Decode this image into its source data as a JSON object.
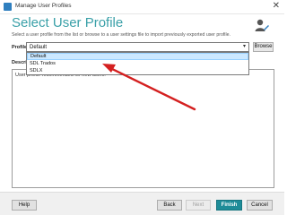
{
  "window": {
    "title": "Manage User Profiles",
    "close_glyph": "✕"
  },
  "main": {
    "heading": "Select User Profile",
    "subtitle": "Select a user profile from the list or browse to a user settings file to import previously exported user profile.",
    "profile_label": "Profile",
    "selected_profile": "Default",
    "browse_label": "Browse",
    "description_label": "Description",
    "description_text": "User profile recommended for new users."
  },
  "dropdown": {
    "options": [
      "Default",
      "SDL Trados",
      "SDLX"
    ],
    "highlighted_index": 0
  },
  "footer": {
    "help": "Help",
    "back": "Back",
    "next": "Next",
    "finish": "Finish",
    "cancel": "Cancel"
  },
  "colors": {
    "accent": "#3aa0a8",
    "primary_button": "#1e8c98",
    "annotation_arrow": "#d42020",
    "highlight": "#cce8ff"
  },
  "icons": [
    "app-icon",
    "close-icon",
    "user-profile-icon",
    "chevron-down-icon"
  ]
}
